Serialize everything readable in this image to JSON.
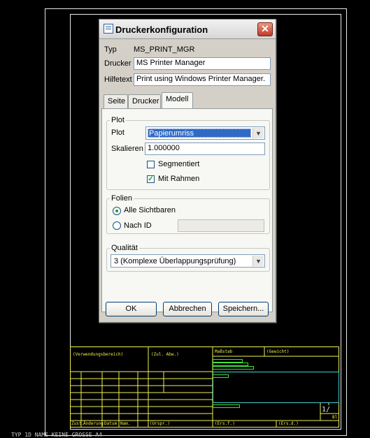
{
  "status_bar": {
    "text": "TYP 1D   NAME KEINE GROSSE A4"
  },
  "title_block": {
    "cells": {
      "verwendung": "(Verwendungsbereich)",
      "zul_abw": "(Zul. Abw.)",
      "massstab": "Maßstab",
      "gewicht": "(Gewicht)",
      "zust": "Zust.",
      "aenderung": "Änderung",
      "datum": "Datum",
      "nam": "Nam.",
      "urspr": "(Urspr.)",
      "ers_f": "(Ers.f.)",
      "ers_d": "(Ers.d.)",
      "sheet": "1/",
      "bl": "Bl"
    }
  },
  "dialog": {
    "title": "Druckerkonfiguration",
    "close_symbol": "✕",
    "typ_label": "Typ",
    "typ_value": "MS_PRINT_MGR",
    "drucker_label": "Drucker",
    "drucker_value": "MS Printer Manager",
    "hilfetext_label": "Hilfetext",
    "hilfetext_value": "Print using Windows Printer Manager.",
    "tabs": [
      {
        "label": "Seite"
      },
      {
        "label": "Drucker"
      },
      {
        "label": "Modell"
      }
    ],
    "plot_group": {
      "legend": "Plot",
      "plot_label": "Plot",
      "plot_value": "Papierumriss",
      "skalieren_label": "Skalieren",
      "skalieren_value": "1.000000",
      "segmentiert_label": "Segmentiert",
      "segmentiert_checked": false,
      "mit_rahmen_label": "Mit Rahmen",
      "mit_rahmen_checked": true
    },
    "folien_group": {
      "legend": "Folien",
      "alle_label": "Alle Sichtbaren",
      "nach_id_label": "Nach ID",
      "selected": "alle",
      "nach_id_value": ""
    },
    "qualitaet_group": {
      "legend": "Qualität",
      "value": "3 (Komplexe Überlappungsprüfung)"
    },
    "buttons": {
      "ok": "OK",
      "abbrechen": "Abbrechen",
      "speichern": "Speichern..."
    },
    "dropdown_arrow": "▼",
    "check_mark": "✓"
  },
  "colors": {
    "background": "#000000",
    "drawing_lines": "#f0f050",
    "drawing_frame": "#e8e8e8",
    "accent_cyan": "#40d0d0",
    "accent_green": "#40e040",
    "selection": "#316ac5"
  }
}
